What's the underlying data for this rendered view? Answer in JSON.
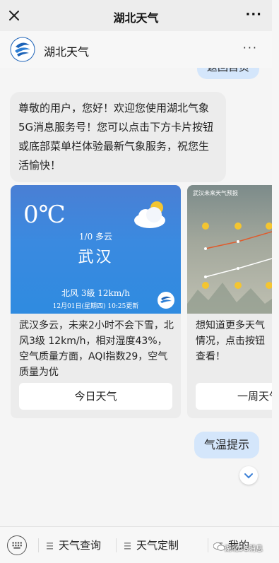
{
  "nav": {
    "title": "湖北天气",
    "more": "···"
  },
  "account": {
    "name": "湖北天气",
    "menu": "···"
  },
  "chat": {
    "prev_user_msg": "返回首页",
    "bot_msg": "尊敬的用户，您好！欢迎您使用湖北气象5G消息服务号！您可以点击下方卡片按钮或底部菜单栏体验最新气象服务，祝您生活愉快！",
    "cards": [
      {
        "temp": "0℃",
        "cond": "1/0 多云",
        "city": "武汉",
        "wind": "北风 3级 12km/h",
        "date": "12月01日(星期四) 10:25更新",
        "desc": "武汉多云，未来2小时不会下雪，北风3级 12km/h，相对湿度43%，空气质量方面，AQI指数29，空气质量为优",
        "button": "今日天气"
      },
      {
        "header": "武汉未来天气预报",
        "desc": "想知道更多天气情况，点击按钮查看！",
        "button": "一周天气"
      }
    ],
    "user_msg": "气温提示"
  },
  "menu": {
    "items": [
      "天气查询",
      "天气定制",
      "我的"
    ],
    "watermark": "湖北5G消息"
  },
  "colors": {
    "user_bubble": "#d4e6fb",
    "bot_bubble": "#ececec",
    "sky": "#3a8ae0"
  }
}
